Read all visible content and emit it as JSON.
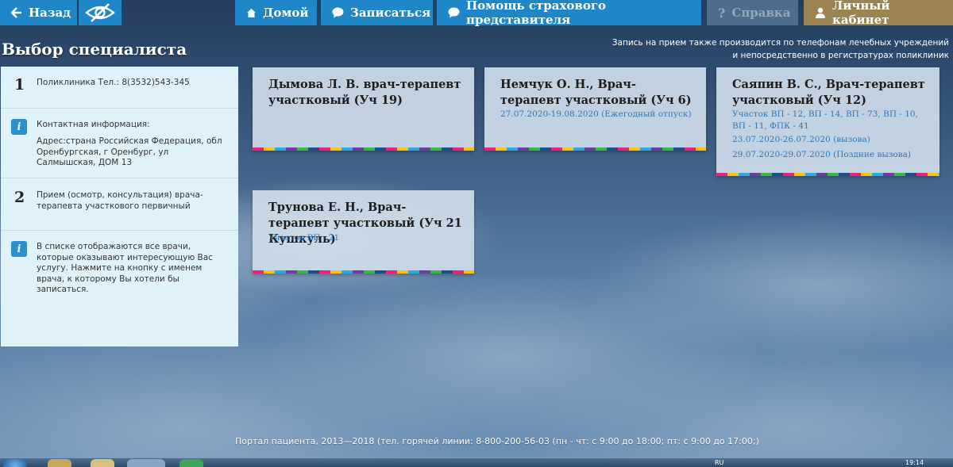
{
  "toolbar": {
    "back_label": "Назад",
    "home_label": "Домой",
    "signup_label": "Записаться",
    "help_label": "Помощь страхового представителя",
    "reference_label": "Справка",
    "cabinet_label": "Личный кабинет"
  },
  "page": {
    "title": "Выбор специалиста",
    "notice_line1": "Запись на прием также производится по телефонам лечебных учреждений",
    "notice_line2": "и непосредственно в регистратурах поликлиник"
  },
  "info": {
    "step1_number": "1",
    "step1_text": "Поликлиника Тел.: 8(3532)543-345",
    "contact_label": "Контактная информация:",
    "contact_address": "Адрес:страна Российская Федерация, обл Оренбургская, г Оренбург, ул Салмышская, ДОМ 13",
    "step2_number": "2",
    "step2_text": "Прием (осмотр, консультация) врача-терапевта участкового первичный",
    "hint_text": "В списке отображаются все врачи, которые оказывают интересующую Вас услугу. Нажмите на кнопку с именем врача, к которому Вы хотели бы записаться."
  },
  "doctors": [
    {
      "name": "Дымова Л. В. врач-терапевт участковый (Уч 19)",
      "meta": []
    },
    {
      "name": "Немчук О. Н., Врач-терапевт участковый (Уч 6)",
      "meta": [
        "27.07.2020-19.08.2020 (Ежегодный отпуск)"
      ]
    },
    {
      "name": "Саяпин В. С., Врач-терапевт участковый (Уч 12)",
      "meta": [
        "Участок ВП - 12, ВП - 14, ВП - 73, ВП - 10, ВП - 11, ФПК - 41",
        "23.07.2020-26.07.2020 (вызова)",
        "29.07.2020-29.07.2020 (Поздние вызова)"
      ]
    },
    {
      "name": "Трунова Е. Н., Врач-терапевт участковый (Уч 21 Кушкуль)",
      "meta": [
        "Участок ВП - 21"
      ]
    }
  ],
  "footer": {
    "text": "Портал пациента, 2013—2018 (тел. горячей линии: 8-800-200-56-03 (пн - чт: с 9:00 до 18:00; пт: с 9:00 до 17:00;)"
  },
  "taskbar": {
    "lang": "RU",
    "time": "19:14"
  },
  "colors": {
    "button_blue": "#1f87c7",
    "button_disabled": "#4e6d8c",
    "button_cabinet": "#9c8352",
    "link_blue": "#2f77b6",
    "panel_bg": "#dff2fa"
  },
  "icons": {
    "back": "arrow-left-icon",
    "eye": "eye-slash-icon",
    "home": "home-icon",
    "signup": "chat-bubble-icon",
    "help": "chat-bubble-icon",
    "reference": "question-icon",
    "cabinet": "user-icon",
    "info": "info-icon"
  }
}
